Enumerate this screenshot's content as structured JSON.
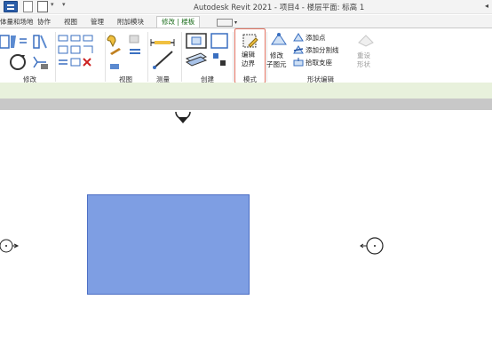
{
  "titlebar": {
    "title": "Autodesk Revit 2021 - 项目4 - 楼层平面: 标高 1",
    "caret": "◂"
  },
  "tabs": [
    {
      "label": "体量和场地"
    },
    {
      "label": "协作"
    },
    {
      "label": "视图"
    },
    {
      "label": "管理"
    },
    {
      "label": "附加模块"
    },
    {
      "label": "修改 | 楼板",
      "active": true
    }
  ],
  "ribbon": {
    "panels": {
      "modify": "修改",
      "view": "视图",
      "measure": "测量",
      "create": "创建",
      "mode": "模式",
      "shape_edit": "形状编辑"
    },
    "buttons": {
      "edit_boundary_line1": "编辑",
      "edit_boundary_line2": "边界",
      "modify_subelements_line1": "修改",
      "modify_subelements_line2": "子图元",
      "add_point": "添加点",
      "add_split_line": "添加分割线",
      "pick_supports": "拾取支座",
      "reset_shape_line1": "重设",
      "reset_shape_line2": "形状"
    }
  },
  "colors": {
    "floor_fill": "#7e9ee3",
    "mode_highlight": "#e07060",
    "active_tab_text": "#1f6f1f",
    "options_bar": "#e8f1dc"
  }
}
